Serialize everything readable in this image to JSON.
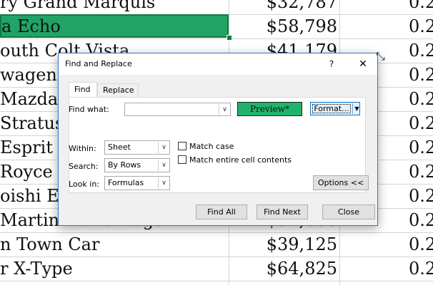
{
  "sheet": {
    "rows": [
      {
        "name": "ry Grand Marquis",
        "price": "$32,787",
        "rate": "0.2"
      },
      {
        "name": "a Echo",
        "price": "$58,798",
        "rate": "0.2"
      },
      {
        "name": "outh Colt Vista",
        "price": "$41,179",
        "rate": "0.2"
      },
      {
        "name": "wagen G",
        "price": "",
        "rate": "0.2"
      },
      {
        "name": "Mazda",
        "price": "",
        "rate": "0.2"
      },
      {
        "name": "Stratus",
        "price": "",
        "rate": "0.2"
      },
      {
        "name": "Esprit",
        "price": "",
        "rate": "0.2"
      },
      {
        "name": "Royce P",
        "price": "",
        "rate": "0.2"
      },
      {
        "name": "oishi Ec",
        "price": "",
        "rate": "0.2"
      },
      {
        "name": "Martin V8 Vantage",
        "price": "$52,655",
        "rate": "0.2"
      },
      {
        "name": "n Town Car",
        "price": "$39,125",
        "rate": "0.2"
      },
      {
        "name": "r X-Type",
        "price": "$64,825",
        "rate": "0.2"
      }
    ],
    "colors": {
      "selected_fill": "#21a366",
      "selected_border": "#107c41",
      "gridline": "#d4d4d4"
    }
  },
  "dialog": {
    "title": "Find and Replace",
    "help_glyph": "?",
    "close_glyph": "✕",
    "resize_glyph": "⤡",
    "tabs": {
      "find": "Find",
      "replace": "Replace"
    },
    "find_what_label": "Find what:",
    "find_what_value": "",
    "preview_label": "Preview*",
    "preview_color": "#21b36b",
    "format_label": "Format...",
    "within_label": "Within:",
    "within_value": "Sheet",
    "search_label": "Search:",
    "search_value": "By Rows",
    "lookin_label": "Look in:",
    "lookin_value": "Formulas",
    "match_case_label": "Match case",
    "match_case_checked": false,
    "match_entire_label": "Match entire cell contents",
    "match_entire_checked": false,
    "options_label": "Options <<",
    "find_all_label": "Find All",
    "find_next_label": "Find Next",
    "close_label": "Close",
    "dropdown_glyph": "∨"
  }
}
